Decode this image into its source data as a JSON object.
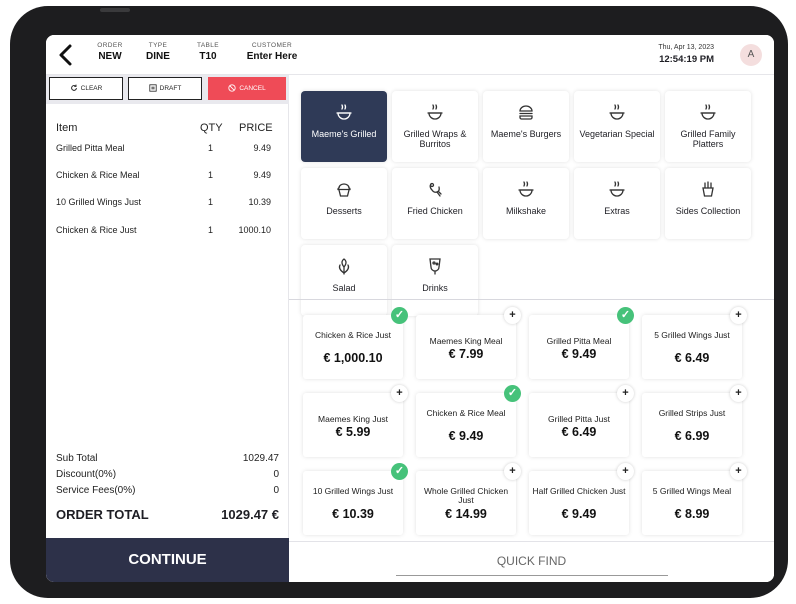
{
  "header": {
    "order_label": "ORDER",
    "order_value": "NEW",
    "type_label": "TYPE",
    "type_value": "DINE",
    "table_label": "TABLE",
    "table_value": "T10",
    "customer_label": "CUSTOMER",
    "customer_value": "Enter Here",
    "date": "Thu, Apr 13, 2023",
    "time": "12:54:19 PM",
    "avatar": "A"
  },
  "actions": {
    "clear": "CLEAR",
    "draft": "DRAFT",
    "cancel": "CANCEL"
  },
  "order": {
    "col_item": "Item",
    "col_qty": "QTY",
    "col_price": "PRICE",
    "rows": [
      {
        "name": "Grilled Pitta Meal",
        "qty": "1",
        "price": "9.49"
      },
      {
        "name": "Chicken & Rice Meal",
        "qty": "1",
        "price": "9.49"
      },
      {
        "name": "10 Grilled Wings Just",
        "qty": "1",
        "price": "10.39"
      },
      {
        "name": "Chicken & Rice Just",
        "qty": "1",
        "price": "1000.10"
      }
    ],
    "subtotal_label": "Sub Total",
    "subtotal": "1029.47",
    "discount_label": "Discount(0%)",
    "discount": "0",
    "service_label": "Service Fees(0%)",
    "service": "0",
    "total_label": "ORDER TOTAL",
    "total": "1029.47 €"
  },
  "continue_label": "CONTINUE",
  "categories": [
    {
      "label": "Maeme's Grilled",
      "icon": "grill-icon",
      "selected": true
    },
    {
      "label": "Grilled Wraps & Burritos",
      "icon": "grill-icon"
    },
    {
      "label": "Maeme's Burgers",
      "icon": "burger-icon"
    },
    {
      "label": "Vegetarian Special",
      "icon": "grill-icon"
    },
    {
      "label": "Grilled Family Platters",
      "icon": "grill-icon"
    },
    {
      "label": "Desserts",
      "icon": "cupcake-icon"
    },
    {
      "label": "Fried Chicken",
      "icon": "chicken-icon"
    },
    {
      "label": "Milkshake",
      "icon": "grill-icon"
    },
    {
      "label": "Extras",
      "icon": "grill-icon"
    },
    {
      "label": "Sides Collection",
      "icon": "fries-icon"
    },
    {
      "label": "Salad",
      "icon": "salad-icon"
    },
    {
      "label": "Drinks",
      "icon": "drink-icon"
    }
  ],
  "items": [
    {
      "name": "Chicken & Rice Just",
      "price": "€ 1,000.10",
      "badge": "check"
    },
    {
      "name": "Maemes King Meal",
      "price": "€ 7.99",
      "badge": "plus"
    },
    {
      "name": "Grilled Pitta Meal",
      "price": "€ 9.49",
      "badge": "check"
    },
    {
      "name": "5 Grilled Wings Just",
      "price": "€ 6.49",
      "badge": "plus"
    },
    {
      "name": "Maemes King Just",
      "price": "€ 5.99",
      "badge": "plus"
    },
    {
      "name": "Chicken & Rice Meal",
      "price": "€ 9.49",
      "badge": "check"
    },
    {
      "name": "Grilled Pitta Just",
      "price": "€ 6.49",
      "badge": "plus"
    },
    {
      "name": "Grilled Strips Just",
      "price": "€ 6.99",
      "badge": "plus"
    },
    {
      "name": "10 Grilled Wings Just",
      "price": "€ 10.39",
      "badge": "check"
    },
    {
      "name": "Whole Grilled Chicken Just",
      "price": "€ 14.99",
      "badge": "plus"
    },
    {
      "name": "Half Grilled Chicken Just",
      "price": "€ 9.49",
      "badge": "plus"
    },
    {
      "name": "5 Grilled Wings Meal",
      "price": "€ 8.99",
      "badge": "plus"
    }
  ],
  "quick_find": "QUICK FIND",
  "colors": {
    "accent_dark": "#2f3a57",
    "continue_bg": "#2d3149",
    "cancel": "#ef4b57",
    "check": "#46c27a"
  }
}
